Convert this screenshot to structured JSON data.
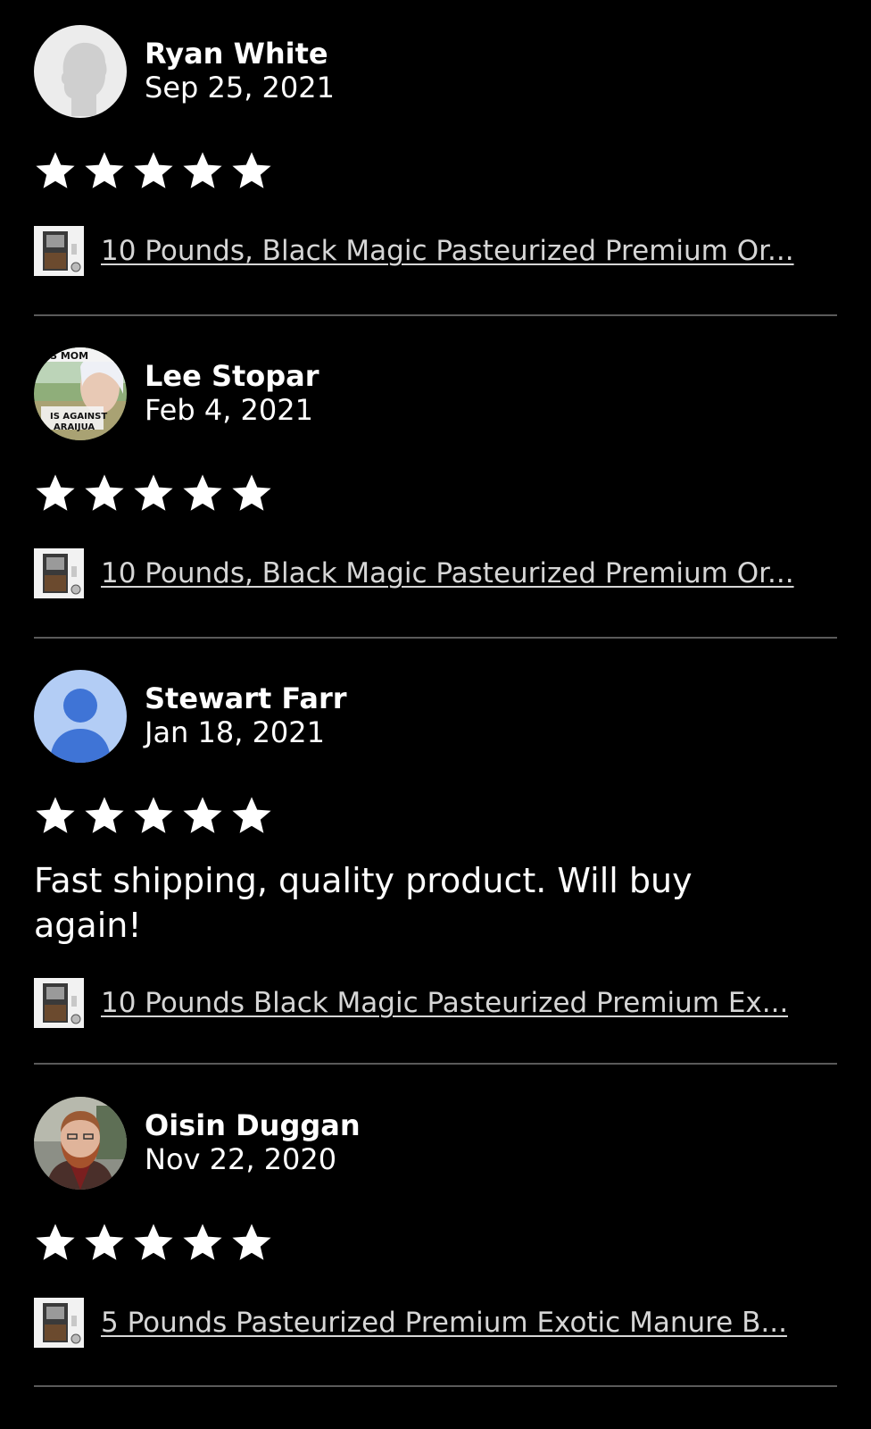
{
  "reviews": [
    {
      "name": "Ryan White",
      "date": "Sep 25, 2021",
      "rating": 5,
      "text": "",
      "product": "10 Pounds, Black Magic Pasteurized Premium Or...",
      "avatar": "default-gray-silhouette-avatar"
    },
    {
      "name": "Lee Stopar",
      "date": "Feb 4, 2021",
      "rating": 5,
      "text": "",
      "product": "10 Pounds, Black Magic Pasteurized Premium Or...",
      "avatar": "photo-avatar",
      "avatar_text": [
        "IS MOM",
        "IS AGAINST",
        "ARAIJUA"
      ]
    },
    {
      "name": "Stewart Farr",
      "date": "Jan 18, 2021",
      "rating": 5,
      "text": "Fast shipping, quality product. Will buy again!",
      "product": "10 Pounds Black Magic Pasteurized Premium Ex...",
      "avatar": "default-blue-person-avatar"
    },
    {
      "name": "Oisin Duggan",
      "date": "Nov 22, 2020",
      "rating": 5,
      "text": "",
      "product": "5 Pounds Pasteurized Premium Exotic Manure B...",
      "avatar": "photo-avatar"
    }
  ],
  "colors": {
    "background": "#000000",
    "text": "#ffffff",
    "link": "#d6d6d6",
    "divider": "#5a5a5a",
    "star": "#ffffff",
    "default_avatar_blue": "#5b8fe6"
  }
}
